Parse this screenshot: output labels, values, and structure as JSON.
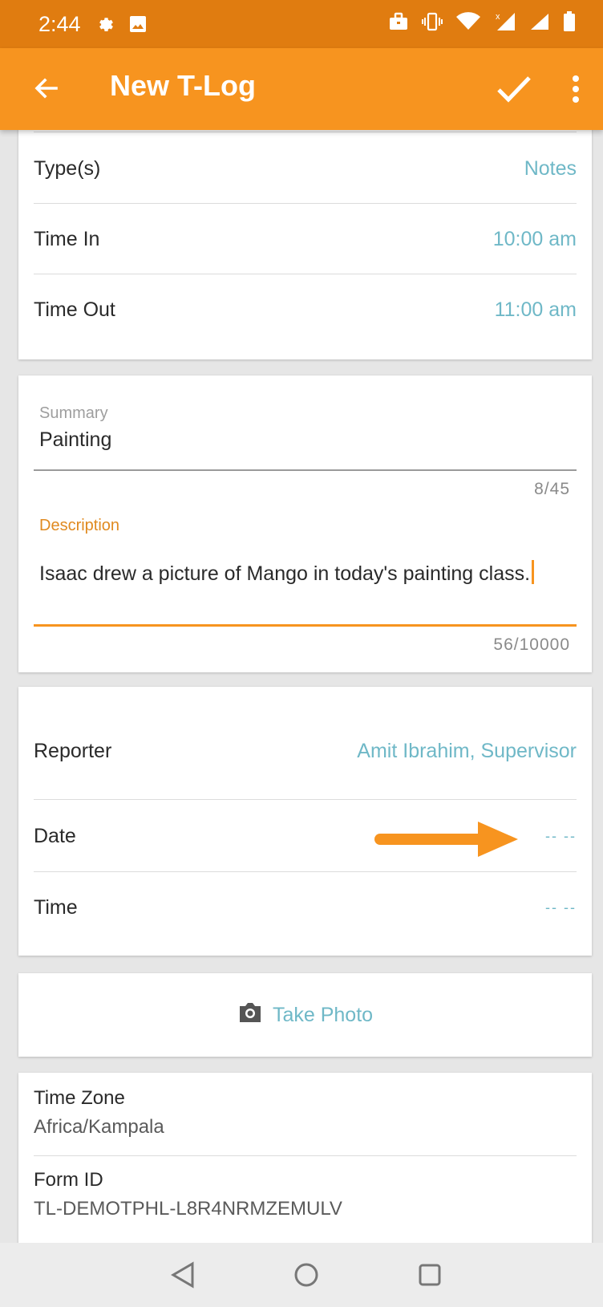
{
  "status_bar": {
    "time": "2:44",
    "icons": [
      "settings-gear-icon",
      "image-icon",
      "briefcase-icon",
      "vibrate-icon",
      "wifi-icon",
      "signal-x-icon",
      "signal-icon",
      "battery-icon"
    ]
  },
  "app_bar": {
    "title": "New T-Log",
    "icons": [
      "back-arrow-icon",
      "check-icon",
      "more-vert-icon"
    ]
  },
  "details_card": {
    "rows": [
      {
        "label": "Type(s)",
        "value": "Notes"
      },
      {
        "label": "Time In",
        "value": "10:00 am"
      },
      {
        "label": "Time Out",
        "value": "11:00 am"
      }
    ]
  },
  "text_card": {
    "summary": {
      "label": "Summary",
      "value": "Painting",
      "counter": "8/45"
    },
    "description": {
      "label": "Description",
      "value": "Isaac drew a picture of Mango in today's painting class.",
      "counter": "56/10000"
    }
  },
  "report_card": {
    "rows": [
      {
        "label": "Reporter",
        "value": "Amit Ibrahim, Supervisor"
      },
      {
        "label": "Date",
        "value": "-- --"
      },
      {
        "label": "Time",
        "value": "-- --"
      }
    ]
  },
  "photo_card": {
    "label": "Take Photo",
    "icon": "camera-icon"
  },
  "info_card": {
    "time_zone": {
      "label": "Time Zone",
      "value": "Africa/Kampala"
    },
    "form_id": {
      "label": "Form ID",
      "value": "TL-DEMOTPHL-L8R4NRMZEMULV"
    }
  },
  "nav_bar": {
    "icons": [
      "nav-back-icon",
      "nav-home-icon",
      "nav-recents-icon"
    ]
  },
  "colors": {
    "status_bar": "#e07c10",
    "app_bar": "#f7941f",
    "accent_value": "#6fb8c7",
    "annotation_arrow": "#f7941f"
  }
}
